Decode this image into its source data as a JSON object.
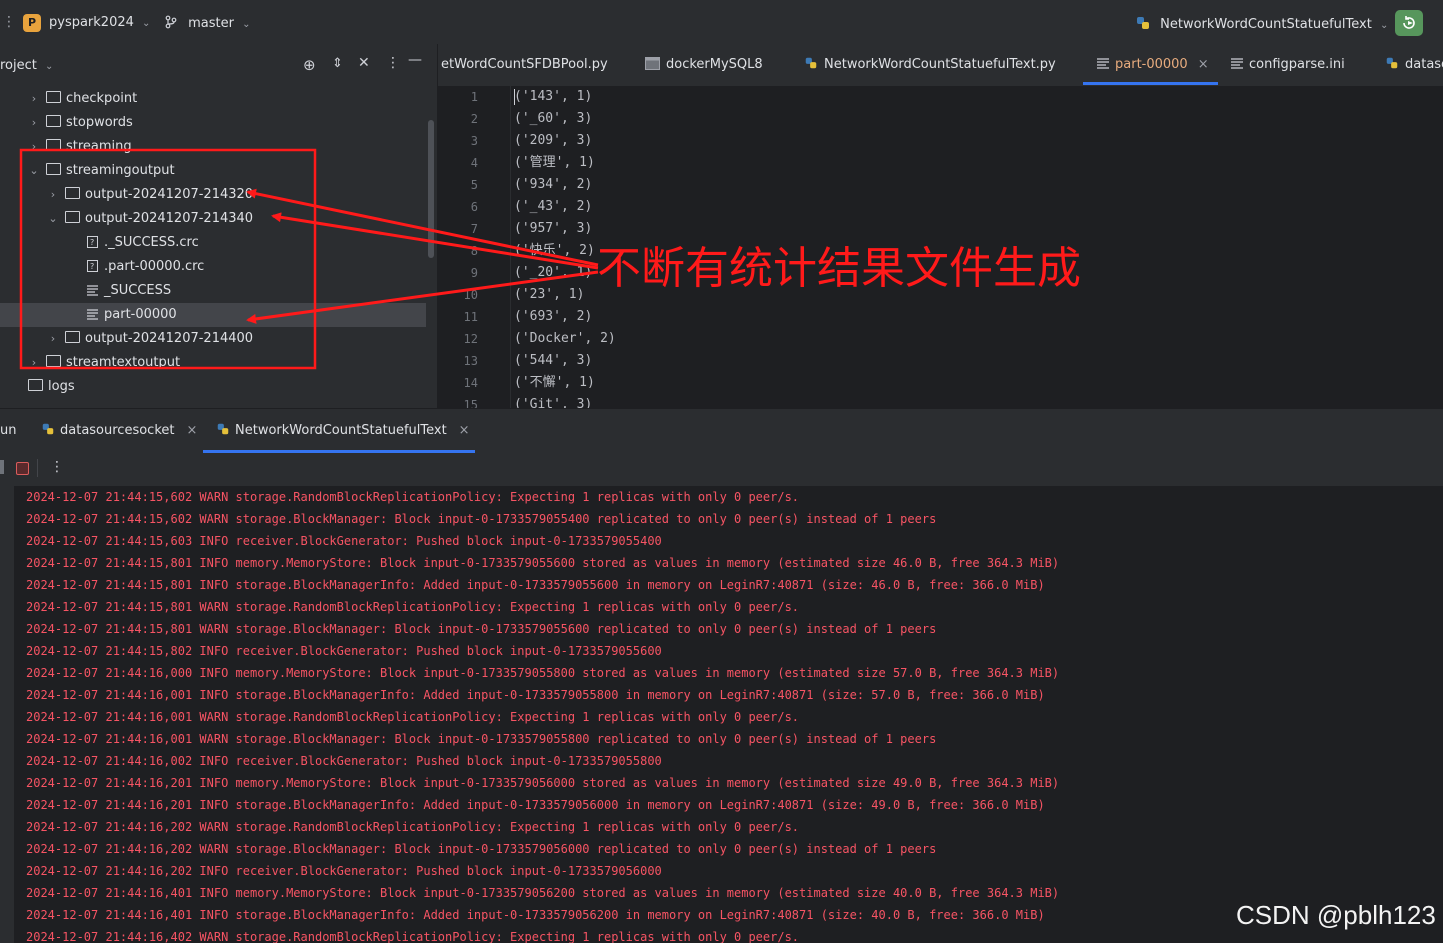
{
  "titlebar": {
    "project_badge": "P",
    "project_name": "pyspark2024",
    "branch": "master",
    "run_config": "NetworkWordCountStatuefulText"
  },
  "project_panel": {
    "title": "roject",
    "tree": [
      {
        "label": "checkpoint",
        "kind": "folder",
        "state": "collapsed"
      },
      {
        "label": "stopwords",
        "kind": "folder",
        "state": "collapsed"
      },
      {
        "label": "streaming",
        "kind": "folder",
        "state": "collapsed"
      },
      {
        "label": "streamingoutput",
        "kind": "folder",
        "state": "expanded"
      },
      {
        "label": "output-20241207-214320",
        "kind": "folder",
        "state": "collapsed"
      },
      {
        "label": "output-20241207-214340",
        "kind": "folder",
        "state": "expanded"
      },
      {
        "label": "._SUCCESS.crc",
        "kind": "crc"
      },
      {
        "label": ".part-00000.crc",
        "kind": "crc"
      },
      {
        "label": "_SUCCESS",
        "kind": "text"
      },
      {
        "label": "part-00000",
        "kind": "text",
        "selected": true
      },
      {
        "label": "output-20241207-214400",
        "kind": "folder",
        "state": "collapsed"
      },
      {
        "label": "streamtextoutput",
        "kind": "folder",
        "state": "collapsed"
      },
      {
        "label": "logs",
        "kind": "folder"
      }
    ]
  },
  "editor_tabs": [
    {
      "label": "etWordCountSFDBPool.py",
      "icon": "python-icon"
    },
    {
      "label": "dockerMySQL8",
      "icon": "terminal-icon"
    },
    {
      "label": "NetworkWordCountStatuefulText.py",
      "icon": "python-icon"
    },
    {
      "label": "part-00000",
      "icon": "text-file-icon",
      "active": true,
      "close": "×"
    },
    {
      "label": "configparse.ini",
      "icon": "text-file-icon"
    },
    {
      "label": "datasc",
      "icon": "python-icon"
    }
  ],
  "editor": {
    "line_numbers": [
      "1",
      "2",
      "3",
      "4",
      "5",
      "6",
      "7",
      "8",
      "9",
      "10",
      "11",
      "12",
      "13",
      "14",
      "15"
    ],
    "lines": [
      "('143', 1)",
      "('_60', 3)",
      "('209', 3)",
      "('管理', 1)",
      "('934', 2)",
      "('_43', 2)",
      "('957', 3)",
      "('快乐', 2)",
      "('_20', 1)",
      "('23', 1)",
      "('693', 2)",
      "('Docker', 2)",
      "('544', 3)",
      "('不懈', 1)",
      "('Git', 3)"
    ]
  },
  "run_window": {
    "label": "un",
    "tabs": [
      {
        "label": "datasourcesocket",
        "close": "×"
      },
      {
        "label": "NetworkWordCountStatuefulText",
        "close": "×",
        "active": true
      }
    ],
    "console": [
      "2024-12-07 21:44:15,602 WARN storage.RandomBlockReplicationPolicy: Expecting 1 replicas with only 0 peer/s.",
      "2024-12-07 21:44:15,602 WARN storage.BlockManager: Block input-0-1733579055400 replicated to only 0 peer(s) instead of 1 peers",
      "2024-12-07 21:44:15,603 INFO receiver.BlockGenerator: Pushed block input-0-1733579055400",
      "2024-12-07 21:44:15,801 INFO memory.MemoryStore: Block input-0-1733579055600 stored as values in memory (estimated size 46.0 B, free 364.3 MiB)",
      "2024-12-07 21:44:15,801 INFO storage.BlockManagerInfo: Added input-0-1733579055600 in memory on LeginR7:40871 (size: 46.0 B, free: 366.0 MiB)",
      "2024-12-07 21:44:15,801 WARN storage.RandomBlockReplicationPolicy: Expecting 1 replicas with only 0 peer/s.",
      "2024-12-07 21:44:15,801 WARN storage.BlockManager: Block input-0-1733579055600 replicated to only 0 peer(s) instead of 1 peers",
      "2024-12-07 21:44:15,802 INFO receiver.BlockGenerator: Pushed block input-0-1733579055600",
      "2024-12-07 21:44:16,000 INFO memory.MemoryStore: Block input-0-1733579055800 stored as values in memory (estimated size 57.0 B, free 364.3 MiB)",
      "2024-12-07 21:44:16,001 INFO storage.BlockManagerInfo: Added input-0-1733579055800 in memory on LeginR7:40871 (size: 57.0 B, free: 366.0 MiB)",
      "2024-12-07 21:44:16,001 WARN storage.RandomBlockReplicationPolicy: Expecting 1 replicas with only 0 peer/s.",
      "2024-12-07 21:44:16,001 WARN storage.BlockManager: Block input-0-1733579055800 replicated to only 0 peer(s) instead of 1 peers",
      "2024-12-07 21:44:16,002 INFO receiver.BlockGenerator: Pushed block input-0-1733579055800",
      "2024-12-07 21:44:16,201 INFO memory.MemoryStore: Block input-0-1733579056000 stored as values in memory (estimated size 49.0 B, free 364.3 MiB)",
      "2024-12-07 21:44:16,201 INFO storage.BlockManagerInfo: Added input-0-1733579056000 in memory on LeginR7:40871 (size: 49.0 B, free: 366.0 MiB)",
      "2024-12-07 21:44:16,202 WARN storage.RandomBlockReplicationPolicy: Expecting 1 replicas with only 0 peer/s.",
      "2024-12-07 21:44:16,202 WARN storage.BlockManager: Block input-0-1733579056000 replicated to only 0 peer(s) instead of 1 peers",
      "2024-12-07 21:44:16,202 INFO receiver.BlockGenerator: Pushed block input-0-1733579056000",
      "2024-12-07 21:44:16,401 INFO memory.MemoryStore: Block input-0-1733579056200 stored as values in memory (estimated size 40.0 B, free 364.3 MiB)",
      "2024-12-07 21:44:16,401 INFO storage.BlockManagerInfo: Added input-0-1733579056200 in memory on LeginR7:40871 (size: 40.0 B, free: 366.0 MiB)",
      "2024-12-07 21:44:16,402 WARN storage.RandomBlockReplicationPolicy: Expecting 1 replicas with only 0 peer/s."
    ]
  },
  "annotation": {
    "text": "不断有统计结果文件生成",
    "color": "#ff1a1a"
  },
  "watermark": "CSDN @pblh123",
  "colors": {
    "accent": "#3574f0",
    "log_text": "#f75464",
    "active_tab_text": "#e8ac7e",
    "run_button": "#57965c",
    "project_badge": "#e8a33d"
  }
}
